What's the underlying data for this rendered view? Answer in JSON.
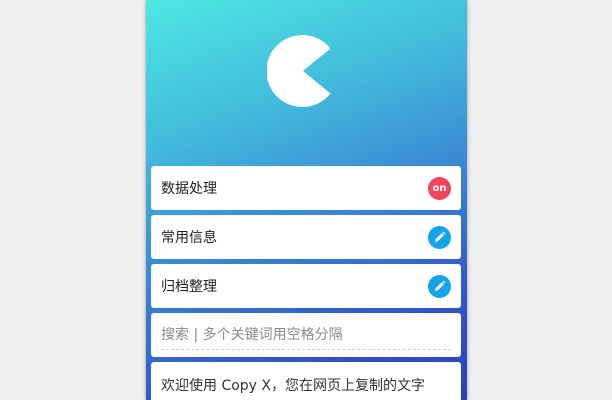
{
  "menu": {
    "items": [
      {
        "label": "数据处理",
        "badge_text": "on",
        "badge_type": "toggle",
        "badge_color": "#f2445f"
      },
      {
        "label": "常用信息",
        "badge_icon": "pencil-icon",
        "badge_color": "#12a5ea"
      },
      {
        "label": "归档整理",
        "badge_icon": "pencil-icon",
        "badge_color": "#12a5ea"
      }
    ]
  },
  "search": {
    "placeholder": "搜索 | 多个关键词用空格分隔"
  },
  "welcome": {
    "text": "欢迎使用 Copy X，您在网页上复制的文字"
  },
  "theme": {
    "gradient_start": "#4de8e2",
    "gradient_end": "#2a3fbf",
    "logo_icon": "pacman-logo-icon"
  }
}
